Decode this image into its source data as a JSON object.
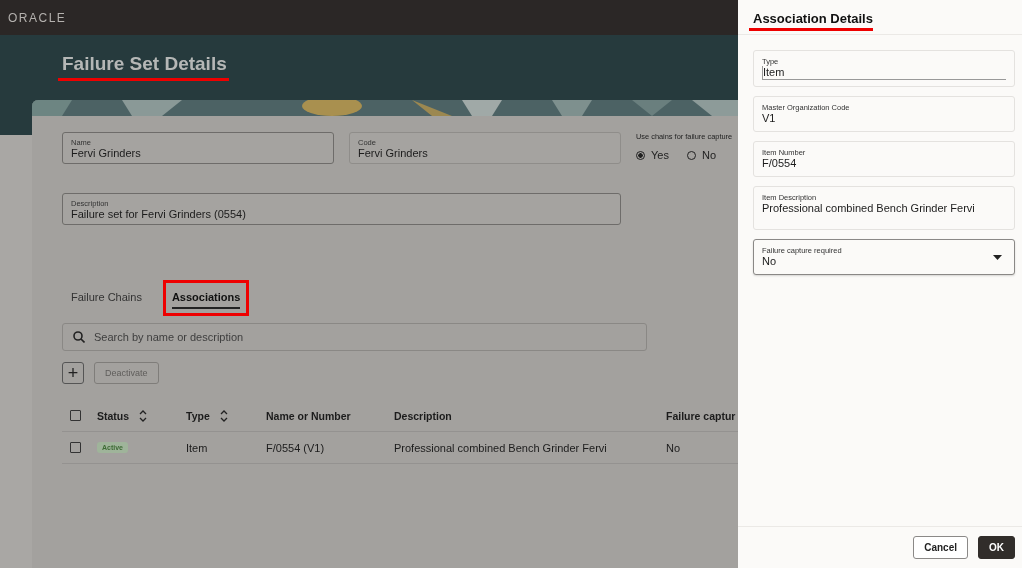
{
  "brand": "ORACLE",
  "page": {
    "title": "Failure Set Details",
    "annotated": true
  },
  "form": {
    "fields": [
      {
        "label": "Name",
        "value": "Fervi Grinders",
        "editable": true
      },
      {
        "label": "Code",
        "value": "Fervi Grinders",
        "editable": false
      }
    ],
    "radio_group": {
      "label": "Use chains for failure capture",
      "options": [
        {
          "label": "Yes",
          "selected": true
        },
        {
          "label": "No",
          "selected": false
        }
      ]
    },
    "description": {
      "label": "Description",
      "value": "Failure set for Fervi Grinders (0554)"
    }
  },
  "tabs": [
    {
      "label": "Failure Chains",
      "selected": false,
      "annotated": false
    },
    {
      "label": "Associations",
      "selected": true,
      "annotated": true
    }
  ],
  "search": {
    "placeholder": "Search by name or description"
  },
  "toolbar": {
    "add": "+",
    "deactivate": {
      "label": "Deactivate",
      "disabled": true
    }
  },
  "table": {
    "columns": [
      {
        "label": "Status",
        "sortable": true
      },
      {
        "label": "Type",
        "sortable": true
      },
      {
        "label": "Name or Number",
        "sortable": false
      },
      {
        "label": "Description",
        "sortable": false
      },
      {
        "label": "Failure captur"
      }
    ],
    "header_checked": false,
    "rows": [
      {
        "checked": false,
        "cells": [
          "Active",
          "Item",
          "F/0554 (V1)",
          "Professional combined Bench Grinder Fervi",
          "No"
        ]
      }
    ]
  },
  "drawer": {
    "title": "Association Details",
    "annotated": true,
    "fields": [
      {
        "kind": "text",
        "label": "Type",
        "value": "Item"
      },
      {
        "kind": "text",
        "label": "Master Organization Code",
        "value": "V1"
      },
      {
        "kind": "text",
        "label": "Item Number",
        "value": "F/0554"
      },
      {
        "kind": "textarea",
        "label": "Item Description",
        "value": "Professional combined Bench Grinder Fervi"
      },
      {
        "kind": "select",
        "label": "Failure capture required",
        "value": "No"
      }
    ],
    "buttons": [
      {
        "label": "Cancel",
        "primary": false
      },
      {
        "label": "OK",
        "primary": true
      }
    ]
  }
}
